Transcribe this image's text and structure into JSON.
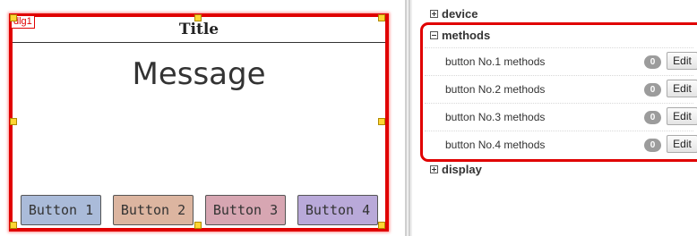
{
  "dialog": {
    "id_label": "dlg1",
    "title": "Title",
    "message": "Message",
    "buttons": [
      {
        "label": "Button 1",
        "color": "#aabbd9"
      },
      {
        "label": "Button 2",
        "color": "#dcb5a0"
      },
      {
        "label": "Button 3",
        "color": "#d7a6b2"
      },
      {
        "label": "Button 4",
        "color": "#b9a9d9"
      }
    ],
    "selection_color": "#e00000"
  },
  "panel": {
    "sections": {
      "device": "device",
      "methods": "methods",
      "display": "display"
    },
    "methods": [
      {
        "label": "button No.1 methods",
        "count": "0",
        "edit": "Edit"
      },
      {
        "label": "button No.2 methods",
        "count": "0",
        "edit": "Edit"
      },
      {
        "label": "button No.3 methods",
        "count": "0",
        "edit": "Edit"
      },
      {
        "label": "button No.4 methods",
        "count": "0",
        "edit": "Edit"
      }
    ],
    "highlight_color": "#e00000"
  }
}
